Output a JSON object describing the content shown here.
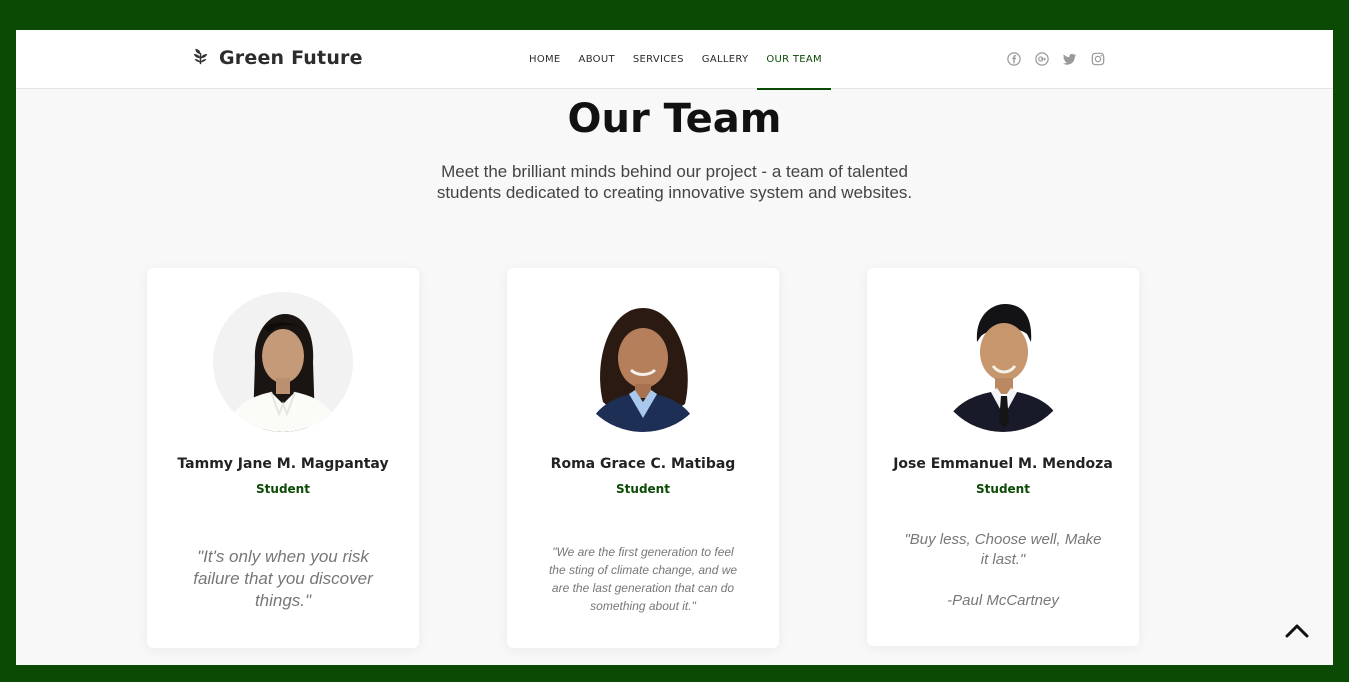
{
  "brand": {
    "name": "Green Future",
    "icon": "leaf-icon"
  },
  "nav": {
    "items": [
      {
        "label": "HOME",
        "active": false
      },
      {
        "label": "ABOUT",
        "active": false
      },
      {
        "label": "SERVICES",
        "active": false
      },
      {
        "label": "GALLERY",
        "active": false
      },
      {
        "label": "OUR TEAM",
        "active": true
      }
    ]
  },
  "social": [
    "facebook-icon",
    "google-plus-icon",
    "twitter-icon",
    "instagram-icon"
  ],
  "section": {
    "title": "Our Team",
    "subtitle": "Meet the brilliant minds behind our project - a team of talented students dedicated to creating innovative system and websites."
  },
  "team": [
    {
      "name": "Tammy Jane M. Magpantay",
      "role": "Student",
      "quote": "\"It's only when you risk failure that you discover things.\""
    },
    {
      "name": "Roma Grace C. Matibag",
      "role": "Student",
      "quote": "\"We are the first generation to feel the sting of climate change, and we are the last generation that can do something about it.\""
    },
    {
      "name": "Jose Emmanuel M. Mendoza",
      "role": "Student",
      "quote": "\"Buy less, Choose well, Make it last.\"",
      "author": "-Paul McCartney"
    }
  ],
  "colors": {
    "accent": "#0b4a05",
    "page_bg": "#f8f8f8",
    "frame": "#0b4a05"
  }
}
